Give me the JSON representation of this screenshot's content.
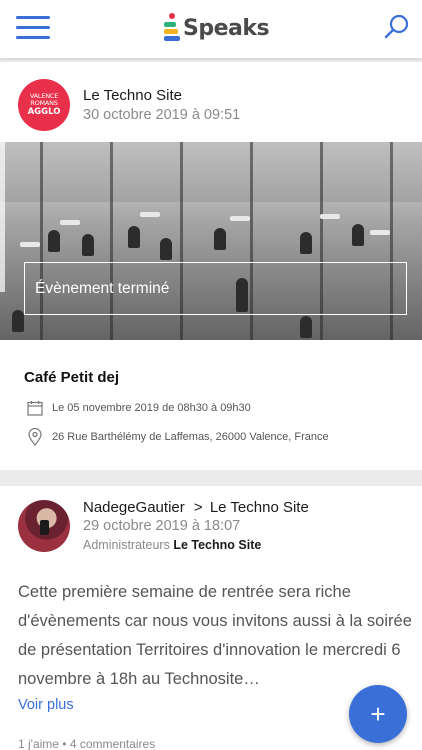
{
  "app": {
    "name": "Speaks",
    "accent": "#3a6fd8"
  },
  "header": {
    "menu_icon": "hamburger-menu-icon",
    "search_icon": "search-icon"
  },
  "post1": {
    "avatar_text": [
      "VALENCE",
      "ROMANS",
      "AGGLO"
    ],
    "source": "Le Techno Site",
    "date": "30 octobre 2019 à 09:51",
    "event_status": "Évènement terminé",
    "event_title": "Café Petit dej",
    "event_date": "Le 05 novembre 2019 de 08h30 à 09h30",
    "event_address": "26 Rue Barthélémy de Laffemas, 26000 Valence, France"
  },
  "post2": {
    "author": "NadegeGautier",
    "separator": ">",
    "group": "Le Techno Site",
    "date": "29 octobre 2019 à 18:07",
    "role_prefix": "Administrateurs",
    "role_group": "Le Techno Site",
    "body": "Cette première semaine de rentrée sera riche d'évènements car nous vous invitons aussi à la soirée de présentation Territoires d'innovation le mercredi 6 novembre à 18h au Technosite…",
    "see_more": "Voir plus",
    "stats": "1 j'aime • 4 commentaires"
  },
  "fab": {
    "label": "+"
  }
}
